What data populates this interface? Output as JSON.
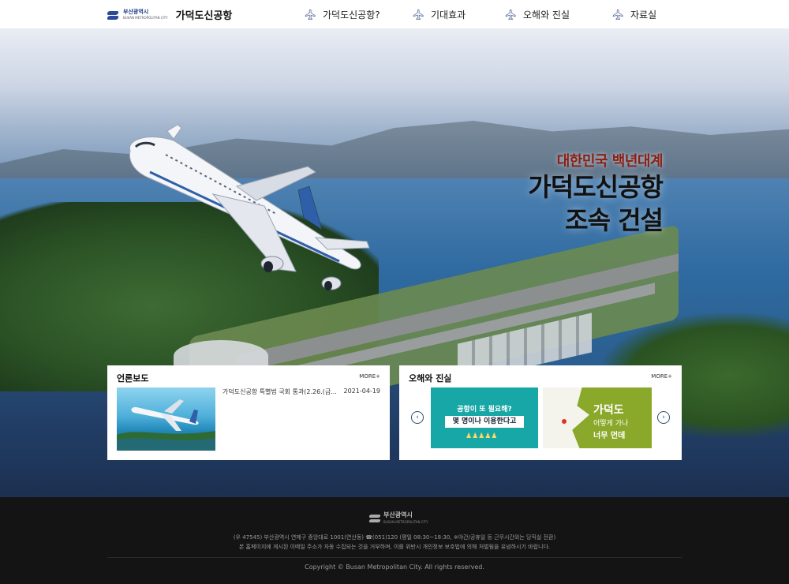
{
  "header": {
    "logo_city": "부산광역시",
    "logo_city_en": "BUSAN METROPOLITAN CITY",
    "site_title": "가덕도신공항",
    "nav": [
      {
        "label": "가덕도신공항?",
        "icon": "airplane-icon"
      },
      {
        "label": "기대효과",
        "icon": "airplane-icon"
      },
      {
        "label": "오해와 진실",
        "icon": "airplane-icon"
      },
      {
        "label": "자료실",
        "icon": "airplane-icon"
      }
    ]
  },
  "hero": {
    "subtitle": "대한민국 백년대계",
    "title_line1": "가덕도신공항",
    "title_line2": "조속 건설"
  },
  "news_panel": {
    "title": "언론보도",
    "more": "MORE+",
    "item": {
      "text": "가덕도신공항 특별법 국회 통과(2.26.(금...",
      "date": "2021-04-19"
    }
  },
  "myth_panel": {
    "title": "오해와 진실",
    "more": "MORE+",
    "prev": "‹",
    "next": "›",
    "card1": {
      "line1": "공항이 또 필요해?",
      "line2": "몇 명이나 이용한다고",
      "people": "♟♟♟♟♟"
    },
    "card2": {
      "line1": "가덕도",
      "line2": "어떻게 가나",
      "line3": "너무 먼데"
    }
  },
  "footer": {
    "city": "부산광역시",
    "city_en": "BUSAN METROPOLITAN CITY",
    "address": "(우 47545) 부산광역시 연제구 중앙대로 1001(연산동) ☎(051)120 (평일 08:30~18:30, ※야간/공휴일 등 근무시간외는 당직실 전환)",
    "notice": "본 홈페이지에 게시된 이메일 주소가 자동 수집되는 것을 거부하며, 이를 위반시 개인정보 보호법에 의해 처벌됨을 유념하시기 바랍니다.",
    "copyright": "Copyright © Busan Metropolitan City. All rights reserved."
  },
  "colors": {
    "subtitle_red": "#8a1f14",
    "teal_card": "#17a7a6",
    "green_card": "#8aa82a",
    "footer_bg": "#141414"
  }
}
